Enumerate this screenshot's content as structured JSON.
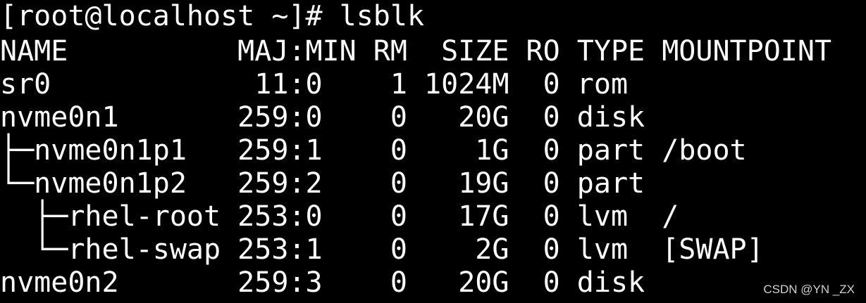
{
  "terminal": {
    "prompt": "[root@localhost ~]# lsblk",
    "header": "NAME          MAJ:MIN RM  SIZE RO TYPE MOUNTPOINT",
    "rows": [
      "sr0            11:0    1 1024M  0 rom",
      "nvme0n1       259:0    0   20G  0 disk",
      "├─nvme0n1p1   259:1    0    1G  0 part /boot",
      "└─nvme0n1p2   259:2    0   19G  0 part",
      "  ├─rhel-root 253:0    0   17G  0 lvm  /",
      "  └─rhel-swap 253:1    0    2G  0 lvm  [SWAP]",
      "nvme0n2       259:3    0   20G  0 disk"
    ]
  },
  "watermark": "CSDN @YN _ZX",
  "colors": {
    "background": "#000000",
    "text": "#ffffff"
  }
}
